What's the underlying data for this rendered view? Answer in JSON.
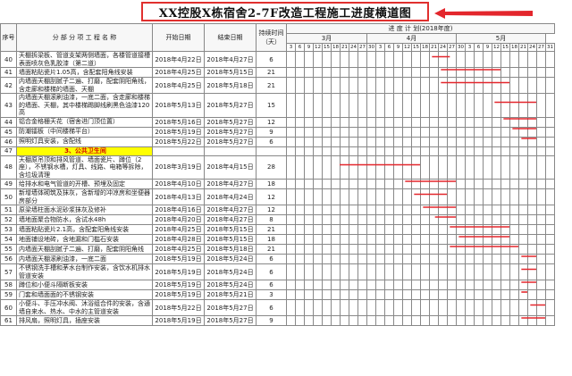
{
  "title": "XX控股X栋宿舍2-7F改造工程施工进度横道图",
  "colors": {
    "bar": "#e3262c",
    "title_border": "#e0302e",
    "arrow": "#e3262c",
    "section_bg": "#ffff00",
    "section_text": "#d40000"
  },
  "header": {
    "seq": "序号",
    "item": "分 部 分 项 工 程 名 称",
    "start": "开始日期",
    "end": "结束日期",
    "dur": "持续时间（天）",
    "progress": "进 度 计 划(2018年度)",
    "months": [
      {
        "label": "3月",
        "span": 9
      },
      {
        "label": "4月",
        "span": 10
      },
      {
        "label": "5月",
        "span": 10
      }
    ],
    "days": [
      "3",
      "6",
      "9",
      "12",
      "15",
      "18",
      "21",
      "24",
      "27",
      "30",
      "3",
      "6",
      "9",
      "12",
      "15",
      "18",
      "21",
      "24",
      "27",
      "30",
      "3",
      "6",
      "9",
      "12",
      "15",
      "18",
      "21",
      "24",
      "27",
      "31"
    ]
  },
  "rows": [
    {
      "seq": "40",
      "name": "天棚拆梁板、管道支架两侧墙面，各楼管道接槽表面喷灰色乳胶漆（第二道）",
      "start": "2018年4月22日",
      "end": "2018年4月27日",
      "dur": "6",
      "bar": [
        49,
        55
      ]
    },
    {
      "seq": "41",
      "name": "墙面粘贴瓷片1.05高，含配套阳角线安装",
      "start": "2018年4月25日",
      "end": "2018年5月15日",
      "dur": "21",
      "bar": [
        52,
        72
      ]
    },
    {
      "seq": "42",
      "name": "内墙面天棚刮腻子二遍、打磨，配套阴阳角线，含走廊和楼梯的墙面、天棚",
      "start": "2018年4月25日",
      "end": "2018年5月18日",
      "dur": "21",
      "bar": [
        52,
        75
      ]
    },
    {
      "seq": "43",
      "name": "内墙面天棚滚刷油漆，一底二面，含走廊和楼梯的墙面、天棚，其中楼梯踢脚线刷黑色油漆120高",
      "start": "2018年5月13日",
      "end": "2018年5月27日",
      "dur": "15",
      "bar": [
        70,
        84
      ]
    },
    {
      "seq": "44",
      "name": "铝合金格栅天花（宿舍进门顶位置）",
      "start": "2018年5月16日",
      "end": "2018年5月27日",
      "dur": "12",
      "bar": [
        73,
        84
      ]
    },
    {
      "seq": "45",
      "name": "防潮镭板（中间楼梯平台）",
      "start": "2018年5月19日",
      "end": "2018年5月27日",
      "dur": "9",
      "bar": [
        76,
        84
      ]
    },
    {
      "seq": "46",
      "name": "照明灯具安装，含配线",
      "start": "2018年5月22日",
      "end": "2018年5月27日",
      "dur": "6",
      "bar": [
        79,
        84
      ]
    },
    {
      "seq": "47",
      "name": "3、公共卫生间",
      "start": "",
      "end": "",
      "dur": "",
      "section": true
    },
    {
      "seq": "48",
      "name": "天棚原吊顶和排风管道、墙面瓷片、蹲位（2座），不锈钢水槽，灯具、线路、电箱等拆除，含垃圾清理",
      "start": "2018年3月19日",
      "end": "2018年4月15日",
      "dur": "28",
      "bar": [
        18,
        45
      ]
    },
    {
      "seq": "49",
      "name": "给排水和电气管道的开槽、预埋及固定",
      "start": "2018年4月10日",
      "end": "2018年4月27日",
      "dur": "18",
      "bar": [
        40,
        57
      ]
    },
    {
      "seq": "50",
      "name": "新增墙体砌筑及抹灰，含新增的冲凉房和坐便器房部分",
      "start": "2018年4月13日",
      "end": "2018年4月24日",
      "dur": "12",
      "bar": [
        43,
        54
      ]
    },
    {
      "seq": "51",
      "name": "原梁墙柱面水泥砂浆抹灰及修补",
      "start": "2018年4月16日",
      "end": "2018年4月27日",
      "dur": "12",
      "bar": [
        46,
        57
      ]
    },
    {
      "seq": "52",
      "name": "墙地面聚合物防水，含试水48h",
      "start": "2018年4月20日",
      "end": "2018年4月27日",
      "dur": "8",
      "bar": [
        50,
        57
      ]
    },
    {
      "seq": "53",
      "name": "墙面粘贴瓷片2.1高，含配套阳角线安装",
      "start": "2018年4月25日",
      "end": "2018年5月15日",
      "dur": "21",
      "bar": [
        55,
        75
      ]
    },
    {
      "seq": "54",
      "name": "地面铺设地砖，含地漏和门槛石安装",
      "start": "2018年4月28日",
      "end": "2018年5月15日",
      "dur": "18",
      "bar": [
        58,
        75
      ]
    },
    {
      "seq": "55",
      "name": "内墙面天棚刮腻子二遍、打磨，配套阴阳角线",
      "start": "2018年4月25日",
      "end": "2018年5月18日",
      "dur": "21",
      "bar": [
        55,
        78
      ]
    },
    {
      "seq": "56",
      "name": "内墙面天棚滚刷油漆，一底二面",
      "start": "2018年5月19日",
      "end": "2018年5月24日",
      "dur": "6",
      "bar": [
        79,
        84
      ]
    },
    {
      "seq": "57",
      "name": "不锈钢洗手槽和茅水台制作安装，含饮水机排水管道安装",
      "start": "2018年5月19日",
      "end": "2018年5月24日",
      "dur": "6",
      "bar": [
        79,
        84
      ]
    },
    {
      "seq": "58",
      "name": "蹲位和小便斗隔断板安装",
      "start": "2018年5月19日",
      "end": "2018年5月24日",
      "dur": "6",
      "bar": [
        79,
        84
      ]
    },
    {
      "seq": "59",
      "name": "门套和墙面面的不锈钢安装",
      "start": "2018年5月19日",
      "end": "2018年5月21日",
      "dur": "3",
      "bar": [
        79,
        81
      ]
    },
    {
      "seq": "60",
      "name": "小便斗、手压冲水阀、沐浴组合件的安装，含通墙自来水、热水、中水的主管道安装",
      "start": "2018年5月22日",
      "end": "2018年5月27日",
      "dur": "6",
      "bar": [
        82,
        87
      ]
    },
    {
      "seq": "61",
      "name": "排风扇，照明灯具，插座安装",
      "start": "2018年5月19日",
      "end": "2018年5月27日",
      "dur": "9",
      "bar": [
        79,
        87
      ]
    }
  ]
}
